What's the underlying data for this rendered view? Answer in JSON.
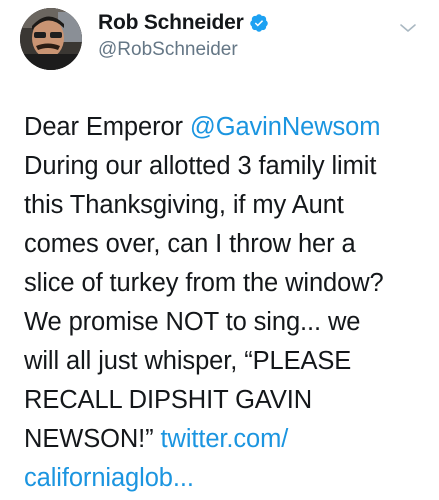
{
  "author": {
    "name": "Rob Schneider",
    "handle": "@RobSchneider",
    "verified": true,
    "avatar_icon": "profile-photo"
  },
  "menu": {
    "icon": "chevron-down-icon"
  },
  "tweet": {
    "line1_prefix": "Dear Emperor ",
    "mention": "@GavinNewsom",
    "line2": "During our allotted 3 family limit",
    "line3": "this Thanksgiving, if my Aunt",
    "line4": "comes over, can I throw her a",
    "line5": "slice of turkey from the window?",
    "line6": "We promise NOT to sing... we",
    "line7": "will all just whisper, “PLEASE",
    "line8": "RECALL DIPSHIT GAVIN",
    "line9_prefix": "NEWSON!” ",
    "link_part1": "twitter.com/",
    "link_part2": "californiaglob..."
  },
  "colors": {
    "text": "#14171a",
    "secondary": "#657786",
    "link": "#1b95e0",
    "verified": "#1da1f2"
  }
}
